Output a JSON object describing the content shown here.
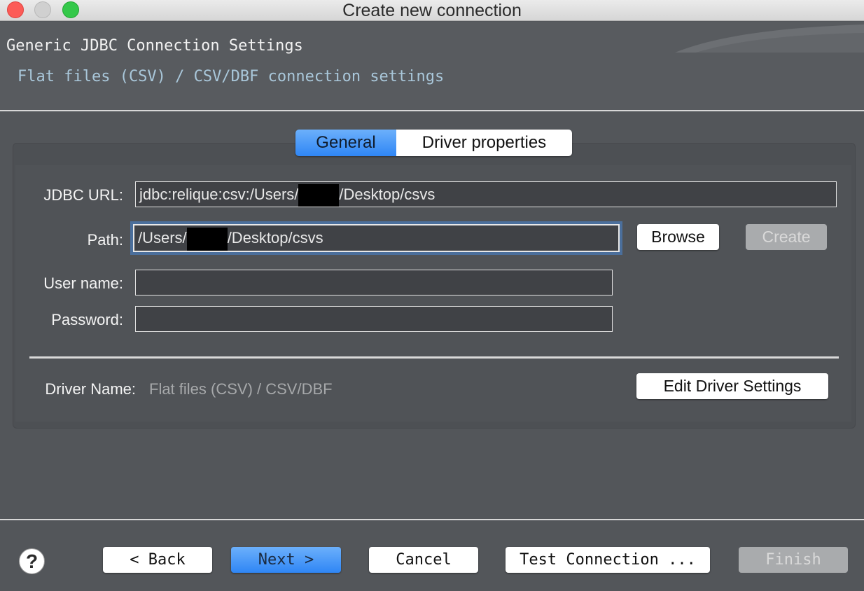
{
  "window": {
    "title": "Create new connection"
  },
  "header": {
    "title": "Generic JDBC Connection Settings",
    "subtitle": "Flat files (CSV) / CSV/DBF connection settings"
  },
  "tabs": [
    {
      "label": "General",
      "active": true
    },
    {
      "label": "Driver properties",
      "active": false
    }
  ],
  "form": {
    "jdbc_url": {
      "label": "JDBC URL:",
      "value_prefix": "jdbc:relique:csv:/Users/",
      "value_suffix": "/Desktop/csvs"
    },
    "path": {
      "label": "Path:",
      "value_prefix": "/Users/",
      "value_suffix": "/Desktop/csvs"
    },
    "user_name": {
      "label": "User name:",
      "value": ""
    },
    "password": {
      "label": "Password:",
      "value": ""
    },
    "browse_label": "Browse",
    "create_label": "Create"
  },
  "driver": {
    "label": "Driver Name:",
    "value": "Flat files (CSV) / CSV/DBF",
    "edit_label": "Edit Driver Settings"
  },
  "footer": {
    "help_symbol": "?",
    "back_label": "< Back",
    "next_label": "Next >",
    "cancel_label": "Cancel",
    "test_label": "Test Connection ...",
    "finish_label": "Finish"
  },
  "colors": {
    "accent": "#2f86f5",
    "background": "#53565a",
    "subtitle": "#a9c7da"
  },
  "icons": {
    "help": "help-icon"
  }
}
